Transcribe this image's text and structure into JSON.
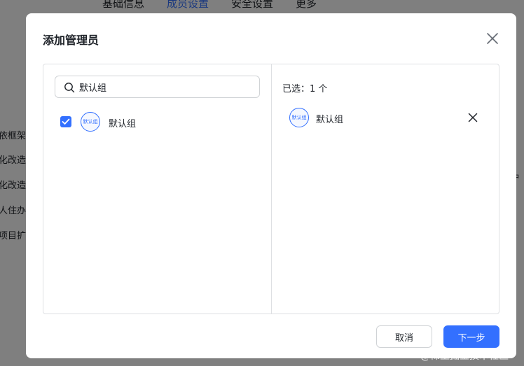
{
  "background": {
    "tabs": [
      "基础信息",
      "成员设置",
      "安全设置",
      "更多"
    ],
    "sidebar_items": [
      "依框架",
      "化改造",
      "化改造",
      "人住办理",
      "项目扩"
    ],
    "edge_text": "户"
  },
  "watermark": "@稀土掘金技术社区",
  "modal": {
    "title": "添加管理员",
    "search": {
      "value": "默认组",
      "placeholder": ""
    },
    "list": [
      {
        "label": "默认组",
        "avatar_text": "默认组",
        "checked": true
      }
    ],
    "selected_count_label": "已选：1 个",
    "selected": [
      {
        "label": "默认组",
        "avatar_text": "默认组"
      }
    ],
    "cancel_label": "取消",
    "next_label": "下一步"
  },
  "colors": {
    "accent": "#3370ff",
    "overlay": "rgba(0,0,0,0.5)",
    "border": "#dee0e3"
  },
  "icons": {
    "close": "close-icon",
    "search": "search-icon",
    "check": "check-icon",
    "remove": "close-icon"
  }
}
